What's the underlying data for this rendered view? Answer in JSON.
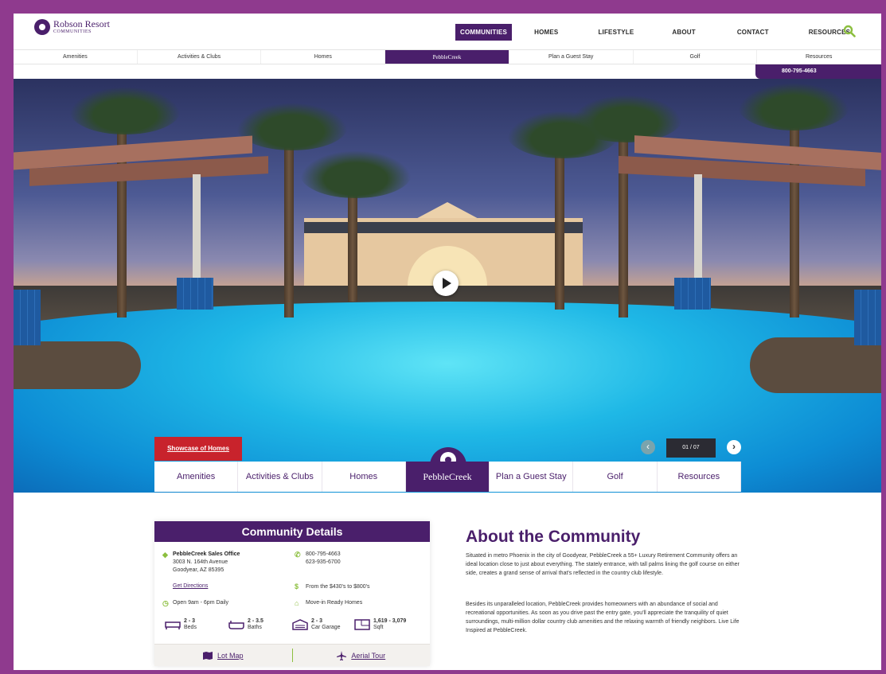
{
  "brand": {
    "logo_title": "Robson Resort",
    "logo_sub": "COMMUNITIES"
  },
  "main_nav": [
    {
      "label": "COMMUNITIES",
      "active": true
    },
    {
      "label": "HOMES"
    },
    {
      "label": "LIFESTYLE"
    },
    {
      "label": "ABOUT"
    },
    {
      "label": "CONTACT"
    },
    {
      "label": "RESOURCES"
    }
  ],
  "sub_nav": [
    "Amenities",
    "Activities & Clubs",
    "Homes",
    "PebbleCreek",
    "Plan a Guest Stay",
    "Golf",
    "Resources"
  ],
  "phone_bar": "800-795-4663",
  "hero": {
    "showcase_label": "Showcase of Homes",
    "slide_counter": "01 / 07"
  },
  "community_tabs": [
    "Amenities",
    "Activities & Clubs",
    "Homes",
    "PebbleCreek",
    "Plan a Guest Stay",
    "Golf",
    "Resources"
  ],
  "details": {
    "title": "Community Details",
    "office_name": "PebbleCreek Sales Office",
    "address_line1": "3003 N. 164th Avenue",
    "address_line2": "Goodyear, AZ 85395",
    "phone1": "800-795-4663",
    "phone2": "623-935-6700",
    "directions": "Get Directions",
    "price": "From the $430's to $800's",
    "hours": "Open 9am - 6pm Daily",
    "move_in": "Move-in Ready Homes",
    "beds_value": "2 - 3",
    "beds_label": "Beds",
    "baths_value": "2 - 3.5",
    "baths_label": "Baths",
    "garage_value": "2 - 3",
    "garage_label": "Car Garage",
    "sqft_value": "1,619 - 3,079",
    "sqft_label": "Sqft",
    "lot_map": "Lot Map",
    "aerial_tour": "Aerial Tour"
  },
  "about": {
    "title": "About the Community",
    "p1": "Situated in metro Phoenix in the city of Goodyear, PebbleCreek a 55+ Luxury Retirement Community offers an ideal location close to just about everything. The stately entrance, with tall palms lining the golf course on either side, creates a grand sense of arrival that's reflected in the country club lifestyle.",
    "p2": "Besides its unparalleled location, PebbleCreek provides homeowners with an abundance of social and recreational opportunities. As soon as you drive past the entry gate, you'll appreciate the tranquility of quiet surroundings, multi-million dollar country club amenities and the relaxing warmth of friendly neighbors. Live Life Inspired at PebbleCreek."
  },
  "colors": {
    "frame": "#8f3a8e",
    "brand_purple": "#4a1f6b",
    "accent_green": "#8cbf3f",
    "showcase_red": "#c8232c"
  }
}
